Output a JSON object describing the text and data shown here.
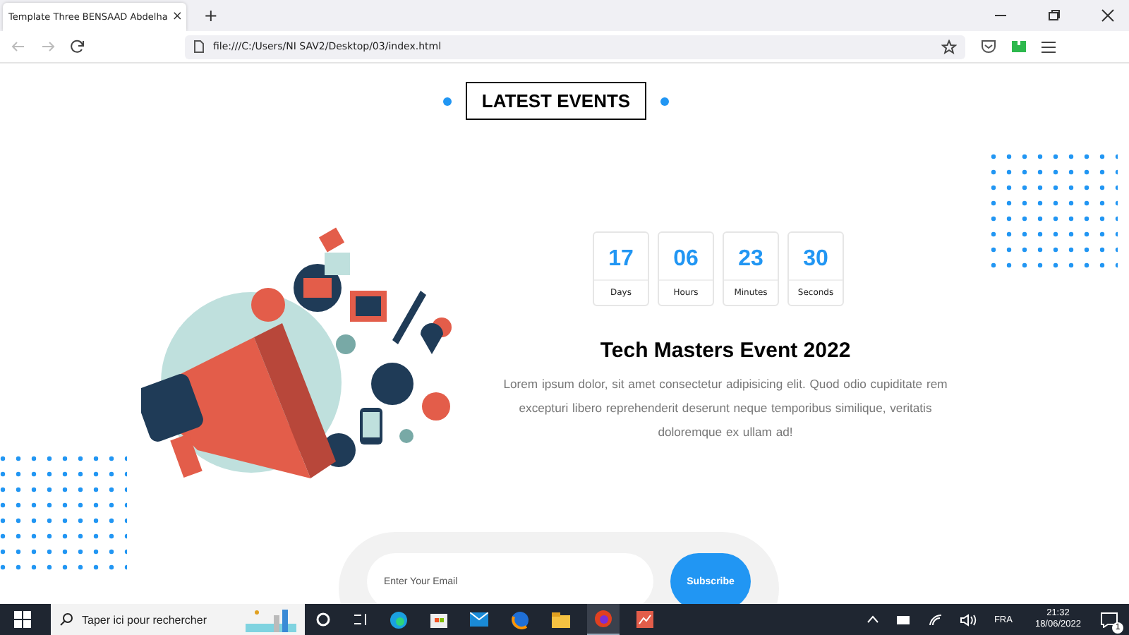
{
  "browser": {
    "tab_title": "Template Three BENSAAD Abdelha",
    "tab_close": "×",
    "new_tab": "+",
    "url": "file:///C:/Users/NI SAV2/Desktop/03/index.html"
  },
  "page": {
    "heading": "LATEST EVENTS",
    "countdown": [
      {
        "value": "17",
        "label": "Days"
      },
      {
        "value": "06",
        "label": "Hours"
      },
      {
        "value": "23",
        "label": "Minutes"
      },
      {
        "value": "30",
        "label": "Seconds"
      }
    ],
    "event_title": "Tech Masters Event 2022",
    "description": "Lorem ipsum dolor, sit amet consectetur adipisicing elit. Quod odio cupiditate rem excepturi libero reprehenderit deserunt neque temporibus similique, veritatis doloremque ex ullam ad!",
    "subscribe": {
      "placeholder": "Enter Your Email",
      "button": "Subscribe"
    }
  },
  "taskbar": {
    "search_placeholder": "Taper ici pour rechercher",
    "language": "FRA",
    "time": "21:32",
    "date": "18/06/2022",
    "notification_count": "1"
  }
}
